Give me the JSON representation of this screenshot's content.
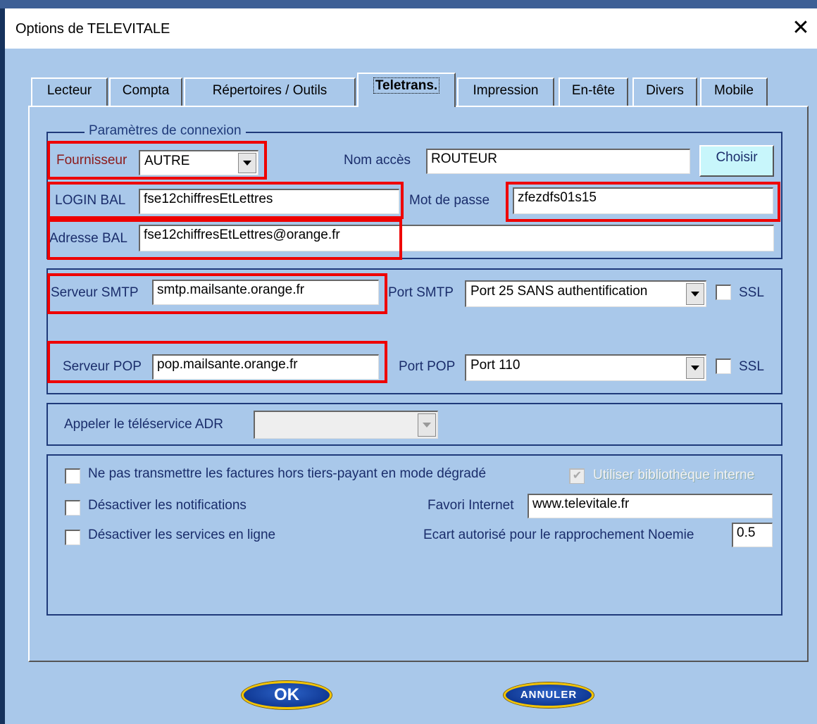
{
  "window": {
    "title": "Options de TELEVITALE",
    "close_icon": "✕"
  },
  "tabs": [
    {
      "label": "Lecteur"
    },
    {
      "label": "Compta"
    },
    {
      "label": "Répertoires / Outils"
    },
    {
      "label": "Teletrans."
    },
    {
      "label": "Impression"
    },
    {
      "label": "En-tête"
    },
    {
      "label": "Divers"
    },
    {
      "label": "Mobile"
    }
  ],
  "active_tab": "Teletrans.",
  "connexion": {
    "legend": "Paramètres de connexion",
    "fournisseur_label": "Fournisseur",
    "fournisseur_value": "AUTRE",
    "nom_acces_label": "Nom accès",
    "nom_acces_value": "ROUTEUR",
    "choisir_label": "Choisir",
    "login_bal_label": "LOGIN BAL",
    "login_bal_value": "fse12chiffresEtLettres",
    "mot_de_passe_label": "Mot de passe",
    "mot_de_passe_value": "zfezdfs01s15",
    "adresse_bal_label": "Adresse BAL",
    "adresse_bal_value": "fse12chiffresEtLettres@orange.fr"
  },
  "servers": {
    "smtp_label": "Serveur SMTP",
    "smtp_value": "smtp.mailsante.orange.fr",
    "port_smtp_label": "Port SMTP",
    "port_smtp_value": "Port 25 SANS authentification",
    "smtp_ssl_label": "SSL",
    "smtp_ssl_checked": false,
    "pop_label": "Serveur POP",
    "pop_value": "pop.mailsante.orange.fr",
    "port_pop_label": "Port POP",
    "port_pop_value": "Port 110",
    "pop_ssl_label": "SSL",
    "pop_ssl_checked": false
  },
  "adr": {
    "label": "Appeler le téléservice ADR",
    "value": ""
  },
  "options": {
    "ne_pas_transmettre_label": "Ne pas transmettre les factures hors tiers-payant en mode dégradé",
    "ne_pas_transmettre_checked": false,
    "utiliser_bibliotheque_label": "Utiliser bibliothèque interne",
    "utiliser_bibliotheque_checked": true,
    "utiliser_bibliotheque_disabled": true,
    "desactiver_notifications_label": "Désactiver les notifications",
    "desactiver_notifications_checked": false,
    "desactiver_services_label": "Désactiver les services en ligne",
    "desactiver_services_checked": false,
    "favori_internet_label": "Favori Internet",
    "favori_internet_value": "www.televitale.fr",
    "ecart_label": "Ecart autorisé pour le rapprochement Noemie",
    "ecart_value": "0.5"
  },
  "buttons": {
    "ok_label": "OK",
    "annuler_label": "ANNULER"
  },
  "colors": {
    "background": "#a9c8ea",
    "highlight_box": "#e00000",
    "group_border": "#1f3a7a",
    "choisir_button": "#c8f6fb",
    "button_gold_rim": "#f4c400",
    "button_blue": "#113a96"
  }
}
